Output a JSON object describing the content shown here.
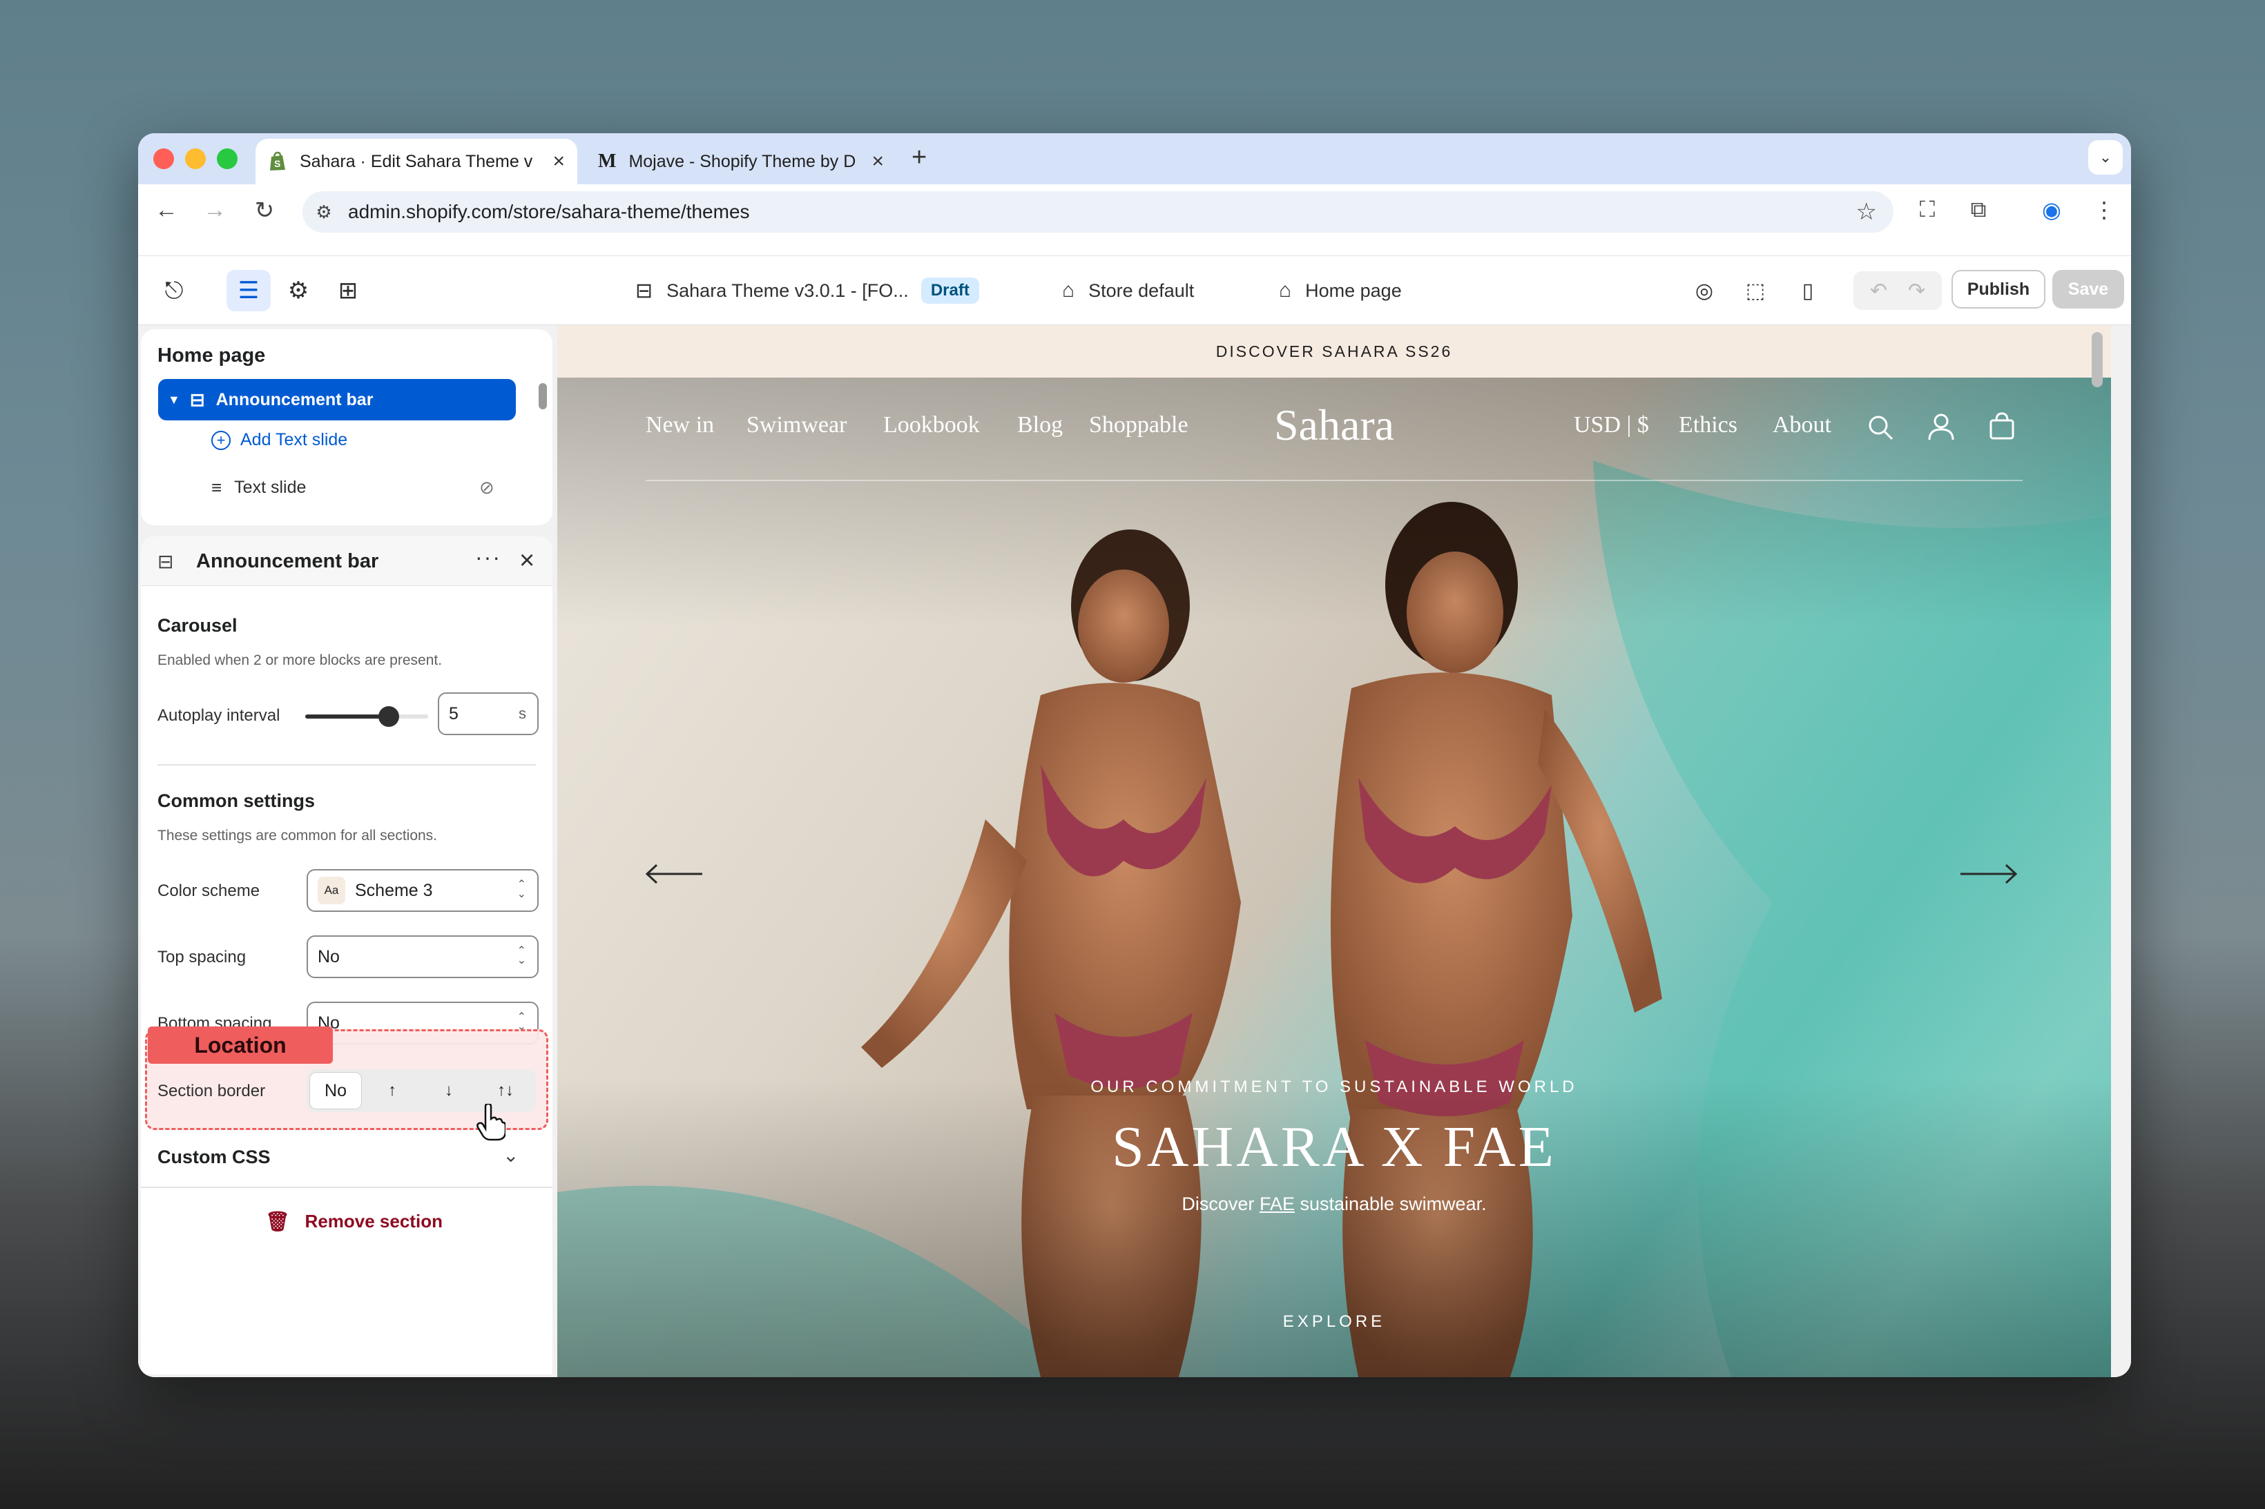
{
  "browser": {
    "tabs": [
      {
        "title": "Sahara · Edit Sahara Theme v",
        "icon": "shopify-icon"
      },
      {
        "title": "Mojave - Shopify Theme by D",
        "icon": "m-logo-icon"
      }
    ],
    "url": "admin.shopify.com/store/sahara-theme/themes"
  },
  "admin_bar": {
    "theme_name": "Sahara Theme v3.0.1 - [FO...",
    "status_badge": "Draft",
    "store_selector": "Store default",
    "page_selector": "Home page",
    "publish_label": "Publish",
    "save_label": "Save"
  },
  "section_tree": {
    "title": "Home page",
    "selected_section": "Announcement bar",
    "add_block_label": "Add Text slide",
    "blocks": [
      {
        "label": "Text slide"
      }
    ]
  },
  "settings": {
    "title": "Announcement bar",
    "carousel_heading": "Carousel",
    "carousel_hint": "Enabled when 2 or more blocks are present.",
    "autoplay_label": "Autoplay interval",
    "autoplay_value": "5",
    "autoplay_unit": "s",
    "autoplay_fraction": 0.68,
    "common_heading": "Common settings",
    "common_hint": "These settings are common for all sections.",
    "color_scheme_label": "Color scheme",
    "color_scheme_swatch": "Aa",
    "color_scheme_value": "Scheme 3",
    "top_spacing_label": "Top spacing",
    "top_spacing_value": "No",
    "bottom_spacing_label": "Bottom spacing",
    "bottom_spacing_value": "No",
    "section_border_label": "Section border",
    "section_border_options": [
      "No",
      "↑",
      "↓",
      "↑↓"
    ],
    "custom_css_label": "Custom CSS",
    "remove_label": "Remove section",
    "location_tag": "Location"
  },
  "preview": {
    "announcement": "DISCOVER SAHARA SS26",
    "nav_left": [
      "New in",
      "Swimwear",
      "Lookbook",
      "Blog",
      "Shoppable"
    ],
    "logo": "Sahara",
    "currency": "USD | $",
    "nav_right": [
      "Ethics",
      "About"
    ],
    "hero_subheading": "OUR COMMITMENT TO SUSTAINABLE WORLD",
    "hero_heading": "SAHARA X FAE",
    "hero_text_before": "Discover ",
    "hero_text_link": "FAE",
    "hero_text_after": " sustainable swimwear.",
    "hero_cta": "EXPLORE"
  },
  "colors": {
    "accent": "#005bd3",
    "danger": "#8e0b21",
    "location_tag": "#ef5d5d"
  }
}
